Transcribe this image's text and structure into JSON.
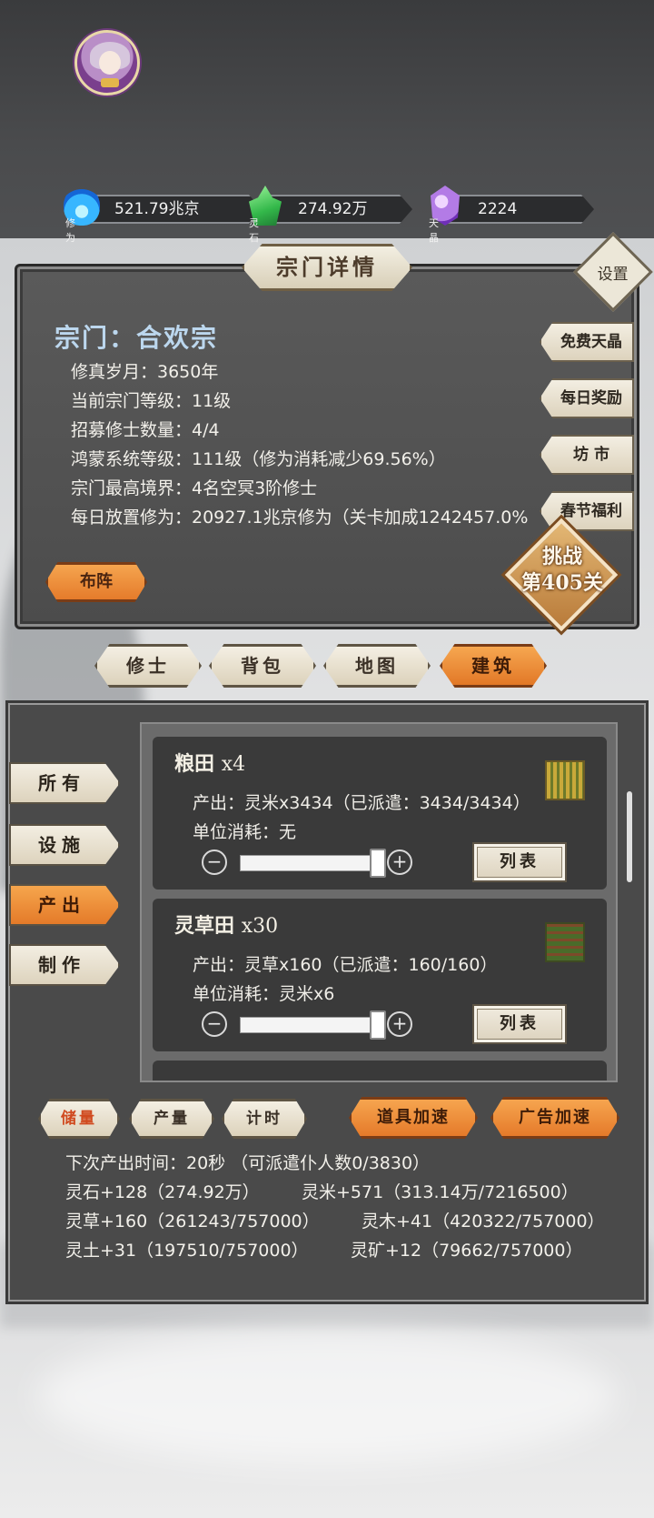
{
  "resources": [
    {
      "icon": "spirit-flame-icon",
      "value": "521.79兆京",
      "caption": "修为"
    },
    {
      "icon": "green-crystal-icon",
      "value": "274.92万",
      "caption": "灵石"
    },
    {
      "icon": "purple-gem-icon",
      "value": "2224",
      "caption": "天晶"
    }
  ],
  "sect_panel": {
    "title": "宗门详情",
    "settings_label": "设置",
    "sect_name": "宗门：合欢宗",
    "info": [
      "修真岁月：3650年",
      "当前宗门等级：11级",
      "招募修士数量：4/4",
      "鸿蒙系统等级：111级（修为消耗减少69.56%）",
      "宗门最高境界：4名空冥3阶修士",
      "每日放置修为：20927.1兆京修为（关卡加成1242457.0%"
    ],
    "side_buttons": [
      "免费天晶",
      "每日奖励",
      "坊 市",
      "春节福利"
    ],
    "challenge": {
      "line1": "挑战",
      "line2": "第405关"
    },
    "formation_label": "布阵"
  },
  "main_tabs": [
    {
      "label": "修士",
      "active": false
    },
    {
      "label": "背包",
      "active": false
    },
    {
      "label": "地图",
      "active": false
    },
    {
      "label": "建筑",
      "active": true
    }
  ],
  "categories": [
    {
      "label": "所有",
      "active": false
    },
    {
      "label": "设施",
      "active": false
    },
    {
      "label": "产出",
      "active": true
    },
    {
      "label": "制作",
      "active": false
    }
  ],
  "buildings": [
    {
      "name": "粮田",
      "count": "x4",
      "output": "产出：灵米x3434（已派遣：3434/3434）",
      "cost": "单位消耗：无",
      "slider_fraction": 1.0,
      "list_label": "列表"
    },
    {
      "name": "灵草田",
      "count": "x30",
      "output": "产出：灵草x160（已派遣：160/160）",
      "cost": "单位消耗：灵米x6",
      "slider_fraction": 1.0,
      "list_label": "列表"
    }
  ],
  "sub_tabs": [
    {
      "label": "储量",
      "active": true
    },
    {
      "label": "产量",
      "active": false
    },
    {
      "label": "计时",
      "active": false
    }
  ],
  "speed_buttons": [
    "道具加速",
    "广告加速"
  ],
  "stats": {
    "next_output": "下次产出时间：20秒 （可派遣仆人数0/3830）",
    "lingshi": "灵石+128（274.92万）",
    "lingmi": "灵米+571（313.14万/7216500）",
    "lingcao": "灵草+160（261243/757000）",
    "lingmu": "灵木+41（420322/757000）",
    "lingtu": "灵土+31（197510/757000）",
    "lingkuang": "灵矿+12（79662/757000）"
  }
}
